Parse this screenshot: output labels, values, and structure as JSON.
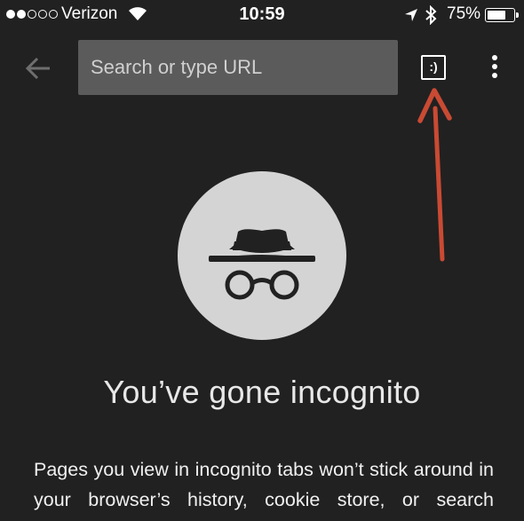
{
  "status_bar": {
    "carrier": "Verizon",
    "time": "10:59",
    "battery_percent": "75%",
    "battery_level": 0.75,
    "signal_bars_filled": 2,
    "signal_bars_total": 5
  },
  "toolbar": {
    "search_placeholder": "Search or type URL",
    "tab_switcher_label": ":)"
  },
  "annotation": {
    "color": "#c94a33"
  },
  "main": {
    "headline": "You’ve gone incognito",
    "body": "Pages you view in incognito tabs won’t stick around in your browser’s history, cookie store, or search"
  },
  "colors": {
    "background": "#212121",
    "url_bar": "#5b5b5b",
    "icon_circle": "#d4d4d4",
    "icon_glyph": "#212121"
  }
}
